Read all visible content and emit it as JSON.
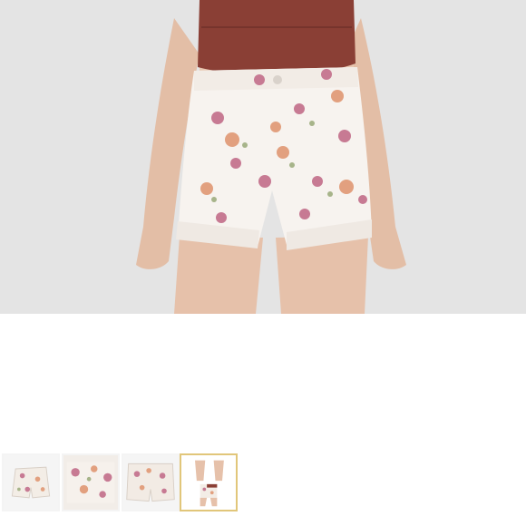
{
  "viewer": {
    "main_image_icon": "floral-shorts-photo",
    "selected_thumbnail_index": 3,
    "thumbnails": [
      {
        "icon": "floral-shorts-flat-photo"
      },
      {
        "icon": "floral-shorts-detail-photo"
      },
      {
        "icon": "floral-shorts-back-photo"
      },
      {
        "icon": "floral-shorts-model-photo"
      }
    ]
  },
  "colors": {
    "background": "#e6e6e6",
    "selected_border": "#e1c67a",
    "top_garment": "#8a3f35",
    "shorts": "#f7f3ef",
    "skin": "#e7c3ac"
  }
}
